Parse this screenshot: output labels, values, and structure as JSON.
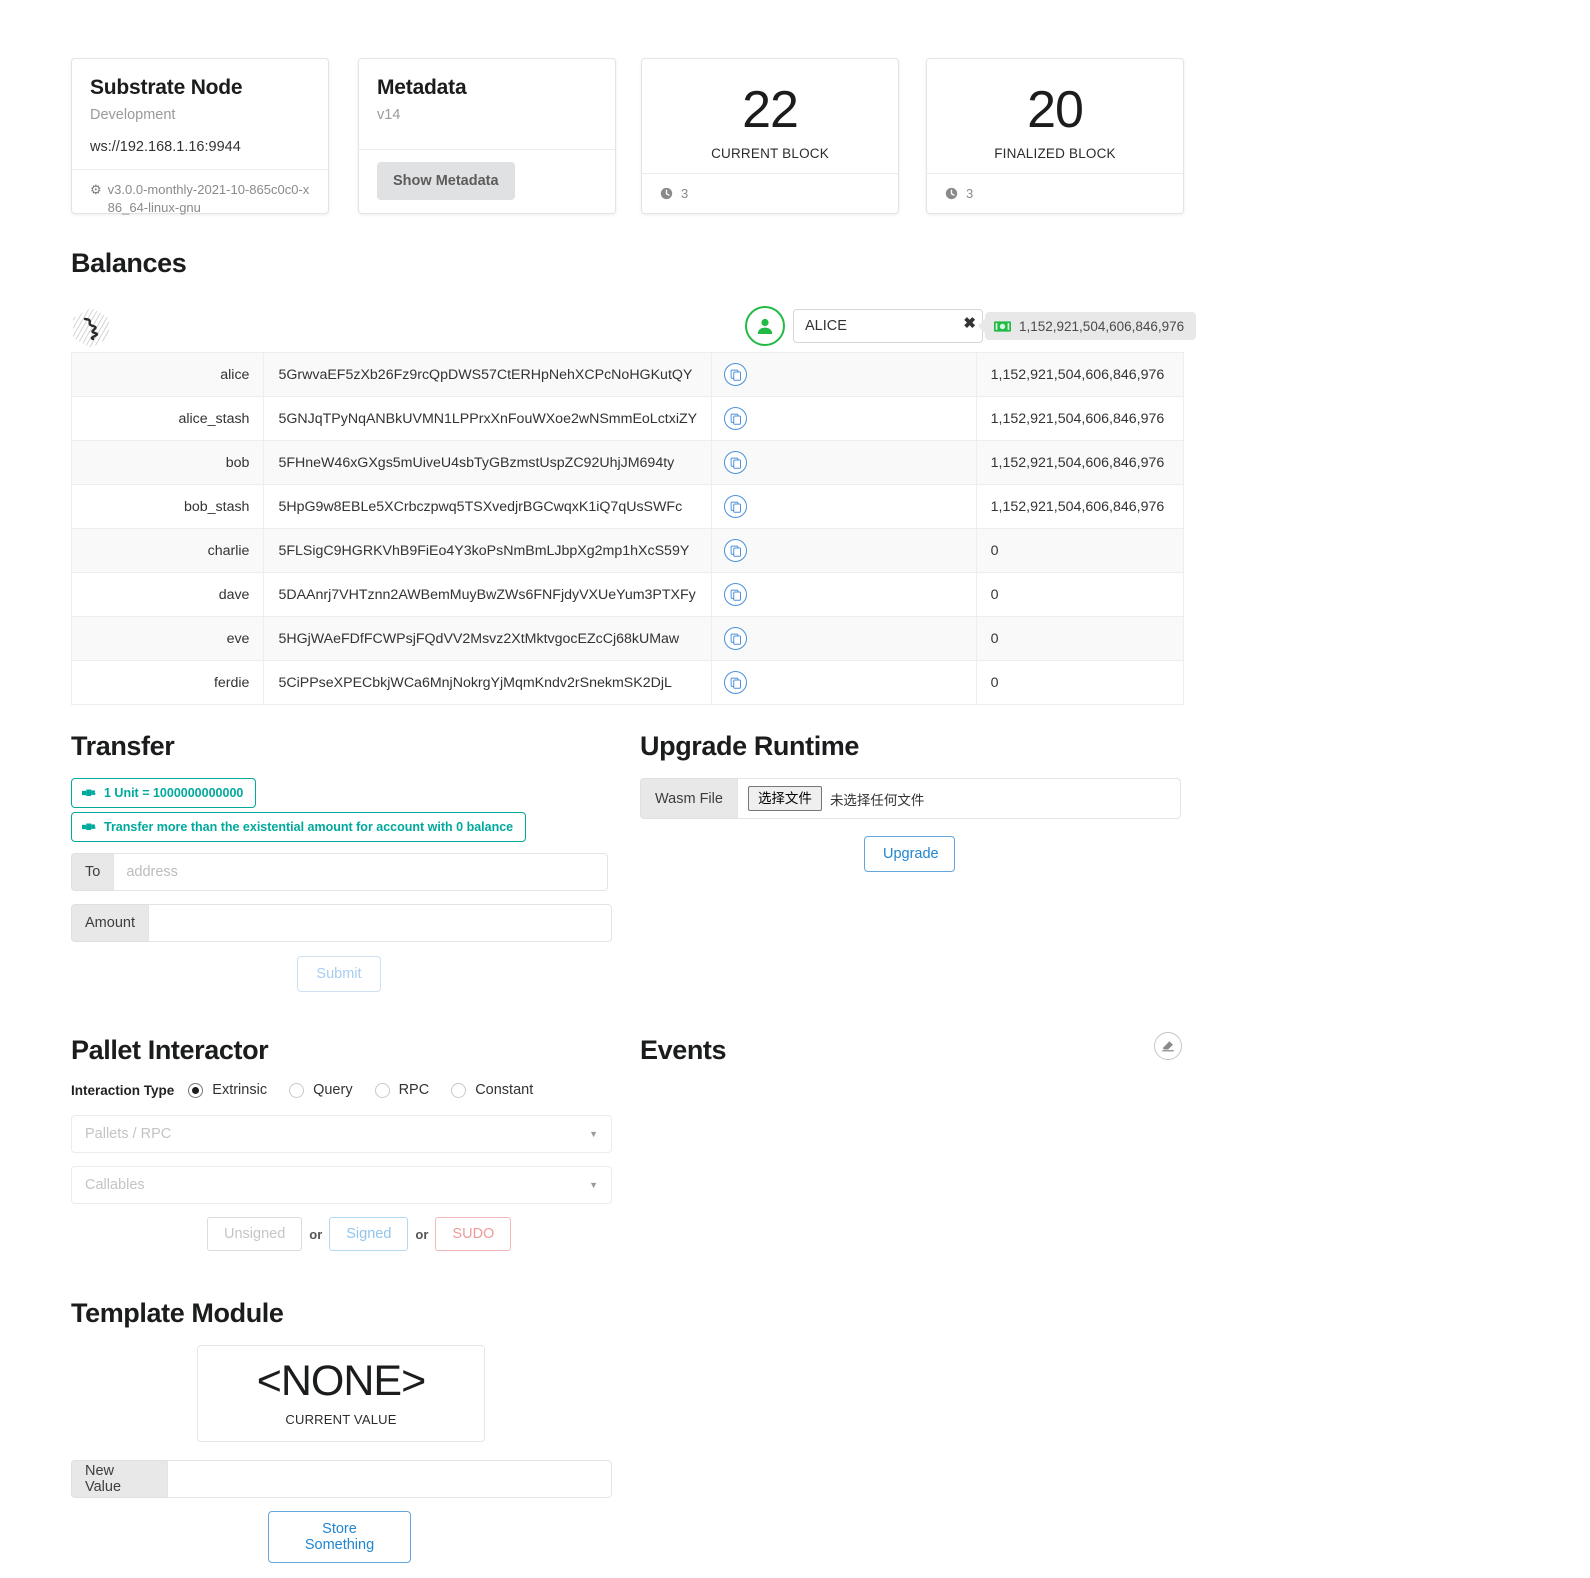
{
  "node_card": {
    "title": "Substrate Node",
    "subtitle": "Development",
    "endpoint": "ws://192.168.1.16:9944",
    "version_icon": "gear-icon",
    "version": "v3.0.0-monthly-2021-10-865c0c0-x86_64-linux-gnu"
  },
  "metadata_card": {
    "title": "Metadata",
    "version": "v14",
    "button_label": "Show Metadata"
  },
  "current_block_card": {
    "value": "22",
    "label": "CURRENT BLOCK",
    "icon": "clock-icon",
    "time": "3"
  },
  "finalized_block_card": {
    "value": "20",
    "label": "FINALIZED BLOCK",
    "icon": "clock-icon",
    "time": "3"
  },
  "balances": {
    "heading": "Balances",
    "logo_icon": "substrate-hex-logo",
    "account_selector": {
      "avatar_icon": "user-icon",
      "avatar_color": "#21ba45",
      "value": "ALICE",
      "clear_icon": "close-icon",
      "balance_icon": "money-bill-icon",
      "balance": "1,152,921,504,606,846,976"
    },
    "rows": [
      {
        "name": "alice",
        "address": "5GrwvaEF5zXb26Fz9rcQpDWS57CtERHpNehXCPcNoHGKutQY",
        "copy_icon": "copy-icon",
        "balance": "1,152,921,504,606,846,976"
      },
      {
        "name": "alice_stash",
        "address": "5GNJqTPyNqANBkUVMN1LPPrxXnFouWXoe2wNSmmEoLctxiZY",
        "copy_icon": "copy-icon",
        "balance": "1,152,921,504,606,846,976"
      },
      {
        "name": "bob",
        "address": "5FHneW46xGXgs5mUiveU4sbTyGBzmstUspZC92UhjJM694ty",
        "copy_icon": "copy-icon",
        "balance": "1,152,921,504,606,846,976"
      },
      {
        "name": "bob_stash",
        "address": "5HpG9w8EBLe5XCrbczpwq5TSXvedjrBGCwqxK1iQ7qUsSWFc",
        "copy_icon": "copy-icon",
        "balance": "1,152,921,504,606,846,976"
      },
      {
        "name": "charlie",
        "address": "5FLSigC9HGRKVhB9FiEo4Y3koPsNmBmLJbpXg2mp1hXcS59Y",
        "copy_icon": "copy-icon",
        "balance": "0"
      },
      {
        "name": "dave",
        "address": "5DAAnrj7VHTznn2AWBemMuyBwZWs6FNFjdyVXUeYum3PTXFy",
        "copy_icon": "copy-icon",
        "balance": "0"
      },
      {
        "name": "eve",
        "address": "5HGjWAeFDfFCWPsjFQdVV2Msvz2XtMktvgocEZcCj68kUMaw",
        "copy_icon": "copy-icon",
        "balance": "0"
      },
      {
        "name": "ferdie",
        "address": "5CiPPseXPECbkjWCa6MnjNokrgYjMqmKndv2rSnekmSK2DjL",
        "copy_icon": "copy-icon",
        "balance": "0"
      }
    ]
  },
  "transfer": {
    "heading": "Transfer",
    "hint_unit": "1 Unit = 1000000000000",
    "hint_existential": "Transfer more than the existential amount for account with 0 balance",
    "hint_icon": "hand-point-right-icon",
    "hint_color": "#00a99d",
    "to_label": "To",
    "to_placeholder": "address",
    "to_value": "",
    "amount_label": "Amount",
    "amount_value": "",
    "submit_label": "Submit"
  },
  "upgrade": {
    "heading": "Upgrade Runtime",
    "wasm_label": "Wasm File",
    "file_button": "选择文件",
    "file_status": "未选择任何文件",
    "upgrade_label": "Upgrade"
  },
  "pallet": {
    "heading": "Pallet Interactor",
    "interaction_type_label": "Interaction Type",
    "options": [
      {
        "label": "Extrinsic",
        "checked": true
      },
      {
        "label": "Query",
        "checked": false
      },
      {
        "label": "RPC",
        "checked": false
      },
      {
        "label": "Constant",
        "checked": false
      }
    ],
    "pallets_placeholder": "Pallets / RPC",
    "callables_placeholder": "Callables",
    "unsigned_label": "Unsigned",
    "or_label_1": "or",
    "signed_label": "Signed",
    "or_label_2": "or",
    "sudo_label": "SUDO"
  },
  "events": {
    "heading": "Events",
    "clear_icon": "eraser-icon"
  },
  "template_module": {
    "heading": "Template Module",
    "current_value": "<NONE>",
    "current_value_label": "CURRENT VALUE",
    "new_value_label": "New Value",
    "new_value": "",
    "store_label": "Store Something"
  }
}
